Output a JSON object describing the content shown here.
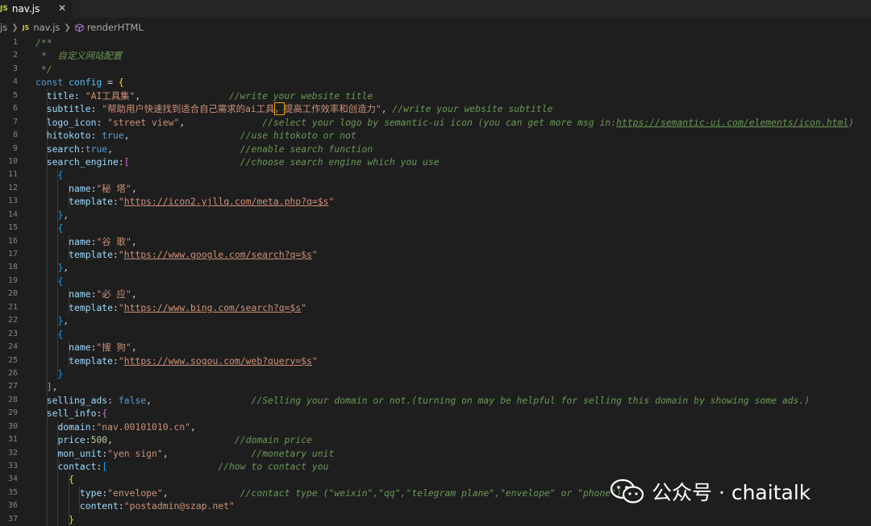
{
  "tab": {
    "badge": "JS",
    "filename": "nav.js",
    "close_glyph": "✕"
  },
  "breadcrumbs": {
    "folder": "js",
    "badge": "JS",
    "file": "nav.js",
    "symbol": "renderHTML",
    "symbol_icon": "method-cube-icon"
  },
  "watermark": {
    "text": "公众号 · chaitalk",
    "icon": "wechat-icon"
  },
  "colors": {
    "background": "#1e1e1e",
    "comment": "#6a9955",
    "string": "#ce9178",
    "keyword": "#569cd6",
    "property": "#9cdcfe",
    "number": "#b5cea8"
  },
  "code_lines": [
    {
      "n": "1",
      "tokens": [
        [
          "c",
          "/**"
        ]
      ]
    },
    {
      "n": "2",
      "tokens": [
        [
          "c",
          " *  自定义网站配置"
        ]
      ]
    },
    {
      "n": "3",
      "tokens": [
        [
          "c",
          " */"
        ]
      ]
    },
    {
      "n": "4",
      "tokens": [
        [
          "k",
          "const"
        ],
        [
          "d",
          " "
        ],
        [
          "v",
          "config"
        ],
        [
          "d",
          " = "
        ],
        [
          "b1",
          "{"
        ]
      ]
    },
    {
      "n": "5",
      "tokens": [
        [
          "d",
          "  "
        ],
        [
          "p",
          "title"
        ],
        [
          "d",
          ": "
        ],
        [
          "s",
          "\"AI工具集\""
        ],
        [
          "d",
          ",                "
        ],
        [
          "c",
          "//write your website title"
        ]
      ]
    },
    {
      "n": "6",
      "tokens": [
        [
          "d",
          "  "
        ],
        [
          "p",
          "subtitle"
        ],
        [
          "d",
          ": "
        ],
        [
          "s",
          "\"帮助用户快速找到适合自己需求的ai工具"
        ],
        [
          "sh",
          "，"
        ],
        [
          "s",
          "提高工作效率和创造力\""
        ],
        [
          "d",
          ", "
        ],
        [
          "c",
          "//write your website subtitle"
        ]
      ]
    },
    {
      "n": "7",
      "tokens": [
        [
          "d",
          "  "
        ],
        [
          "p",
          "logo_icon"
        ],
        [
          "d",
          ": "
        ],
        [
          "s",
          "\"street view\""
        ],
        [
          "d",
          ",              "
        ],
        [
          "c",
          "//select your logo by semantic-ui icon (you can get more msg in:"
        ],
        [
          "cu",
          "https://semantic-ui.com/elements/icon.html"
        ],
        [
          "c",
          ")"
        ]
      ]
    },
    {
      "n": "8",
      "tokens": [
        [
          "d",
          "  "
        ],
        [
          "p",
          "hitokoto"
        ],
        [
          "d",
          ": "
        ],
        [
          "k",
          "true"
        ],
        [
          "d",
          ",                    "
        ],
        [
          "c",
          "//use hitokoto or not"
        ]
      ]
    },
    {
      "n": "9",
      "tokens": [
        [
          "d",
          "  "
        ],
        [
          "p",
          "search"
        ],
        [
          "d",
          ":"
        ],
        [
          "k",
          "true"
        ],
        [
          "d",
          ",                       "
        ],
        [
          "c",
          "//enable search function"
        ]
      ]
    },
    {
      "n": "10",
      "tokens": [
        [
          "d",
          "  "
        ],
        [
          "p",
          "search_engine"
        ],
        [
          "d",
          ":"
        ],
        [
          "b2",
          "["
        ],
        [
          "d",
          "                    "
        ],
        [
          "c",
          "//choose search engine which you use"
        ]
      ]
    },
    {
      "n": "11",
      "tokens": [
        [
          "d",
          "    "
        ],
        [
          "b3",
          "{"
        ]
      ]
    },
    {
      "n": "12",
      "tokens": [
        [
          "d",
          "      "
        ],
        [
          "p",
          "name"
        ],
        [
          "d",
          ":"
        ],
        [
          "s",
          "\"秘 塔\""
        ],
        [
          "d",
          ","
        ]
      ]
    },
    {
      "n": "13",
      "tokens": [
        [
          "d",
          "      "
        ],
        [
          "p",
          "template"
        ],
        [
          "d",
          ":"
        ],
        [
          "s",
          "\""
        ],
        [
          "su",
          "https://icon2.yjllq.com/meta.php?q=$s"
        ],
        [
          "s",
          "\""
        ]
      ]
    },
    {
      "n": "14",
      "tokens": [
        [
          "d",
          "    "
        ],
        [
          "b3",
          "}"
        ],
        [
          "d",
          ","
        ]
      ]
    },
    {
      "n": "15",
      "tokens": [
        [
          "d",
          "    "
        ],
        [
          "b3",
          "{"
        ]
      ]
    },
    {
      "n": "16",
      "tokens": [
        [
          "d",
          "      "
        ],
        [
          "p",
          "name"
        ],
        [
          "d",
          ":"
        ],
        [
          "s",
          "\"谷 歌\""
        ],
        [
          "d",
          ","
        ]
      ]
    },
    {
      "n": "17",
      "tokens": [
        [
          "d",
          "      "
        ],
        [
          "p",
          "template"
        ],
        [
          "d",
          ":"
        ],
        [
          "s",
          "\""
        ],
        [
          "su",
          "https://www.google.com/search?q=$s"
        ],
        [
          "s",
          "\""
        ]
      ]
    },
    {
      "n": "18",
      "tokens": [
        [
          "d",
          "    "
        ],
        [
          "b3",
          "}"
        ],
        [
          "d",
          ","
        ]
      ]
    },
    {
      "n": "19",
      "tokens": [
        [
          "d",
          "    "
        ],
        [
          "b3",
          "{"
        ]
      ]
    },
    {
      "n": "20",
      "tokens": [
        [
          "d",
          "      "
        ],
        [
          "p",
          "name"
        ],
        [
          "d",
          ":"
        ],
        [
          "s",
          "\"必 应\""
        ],
        [
          "d",
          ","
        ]
      ]
    },
    {
      "n": "21",
      "tokens": [
        [
          "d",
          "      "
        ],
        [
          "p",
          "template"
        ],
        [
          "d",
          ":"
        ],
        [
          "s",
          "\""
        ],
        [
          "su",
          "https://www.bing.com/search?q=$s"
        ],
        [
          "s",
          "\""
        ]
      ]
    },
    {
      "n": "22",
      "tokens": [
        [
          "d",
          "    "
        ],
        [
          "b3",
          "}"
        ],
        [
          "d",
          ","
        ]
      ]
    },
    {
      "n": "23",
      "tokens": [
        [
          "d",
          "    "
        ],
        [
          "b3",
          "{"
        ]
      ]
    },
    {
      "n": "24",
      "tokens": [
        [
          "d",
          "      "
        ],
        [
          "p",
          "name"
        ],
        [
          "d",
          ":"
        ],
        [
          "s",
          "\"搜 狗\""
        ],
        [
          "d",
          ","
        ]
      ]
    },
    {
      "n": "25",
      "tokens": [
        [
          "d",
          "      "
        ],
        [
          "p",
          "template"
        ],
        [
          "d",
          ":"
        ],
        [
          "s",
          "\""
        ],
        [
          "su",
          "https://www.sogou.com/web?query=$s"
        ],
        [
          "s",
          "\""
        ]
      ]
    },
    {
      "n": "26",
      "tokens": [
        [
          "d",
          "    "
        ],
        [
          "b3",
          "}"
        ]
      ]
    },
    {
      "n": "27",
      "tokens": [
        [
          "d",
          "  "
        ],
        [
          "b2",
          "]"
        ],
        [
          "d",
          ","
        ]
      ]
    },
    {
      "n": "28",
      "tokens": [
        [
          "d",
          "  "
        ],
        [
          "p",
          "selling_ads"
        ],
        [
          "d",
          ": "
        ],
        [
          "k",
          "false"
        ],
        [
          "d",
          ",                  "
        ],
        [
          "c",
          "//Selling your domain or not.(turning on may be helpful for selling this domain by showing some ads.)"
        ]
      ]
    },
    {
      "n": "29",
      "tokens": [
        [
          "d",
          "  "
        ],
        [
          "p",
          "sell_info"
        ],
        [
          "d",
          ":"
        ],
        [
          "b2",
          "{"
        ]
      ]
    },
    {
      "n": "30",
      "tokens": [
        [
          "d",
          "    "
        ],
        [
          "p",
          "domain"
        ],
        [
          "d",
          ":"
        ],
        [
          "s",
          "\"nav.00101010.cn\""
        ],
        [
          "d",
          ","
        ]
      ]
    },
    {
      "n": "31",
      "tokens": [
        [
          "d",
          "    "
        ],
        [
          "p",
          "price"
        ],
        [
          "d",
          ":"
        ],
        [
          "n",
          "500"
        ],
        [
          "d",
          ",                      "
        ],
        [
          "c",
          "//domain price"
        ]
      ]
    },
    {
      "n": "32",
      "tokens": [
        [
          "d",
          "    "
        ],
        [
          "p",
          "mon_unit"
        ],
        [
          "d",
          ":"
        ],
        [
          "s",
          "\"yen sign\""
        ],
        [
          "d",
          ",               "
        ],
        [
          "c",
          "//monetary unit"
        ]
      ]
    },
    {
      "n": "33",
      "tokens": [
        [
          "d",
          "    "
        ],
        [
          "p",
          "contact"
        ],
        [
          "d",
          ":"
        ],
        [
          "b3",
          "["
        ],
        [
          "d",
          "                    "
        ],
        [
          "c",
          "//how to contact you"
        ]
      ]
    },
    {
      "n": "34",
      "tokens": [
        [
          "d",
          "      "
        ],
        [
          "b1",
          "{"
        ]
      ]
    },
    {
      "n": "35",
      "tokens": [
        [
          "d",
          "        "
        ],
        [
          "p",
          "type"
        ],
        [
          "d",
          ":"
        ],
        [
          "s",
          "\"envelope\""
        ],
        [
          "d",
          ",             "
        ],
        [
          "c",
          "//contact type (\"weixin\",\"qq\",\"telegram plane\",\"envelope\" or \"phone\")"
        ]
      ]
    },
    {
      "n": "36",
      "tokens": [
        [
          "d",
          "        "
        ],
        [
          "p",
          "content"
        ],
        [
          "d",
          ":"
        ],
        [
          "s",
          "\"postadmin@szap.net\""
        ]
      ]
    },
    {
      "n": "37",
      "tokens": [
        [
          "d",
          "      "
        ],
        [
          "b1",
          "}"
        ]
      ]
    }
  ]
}
